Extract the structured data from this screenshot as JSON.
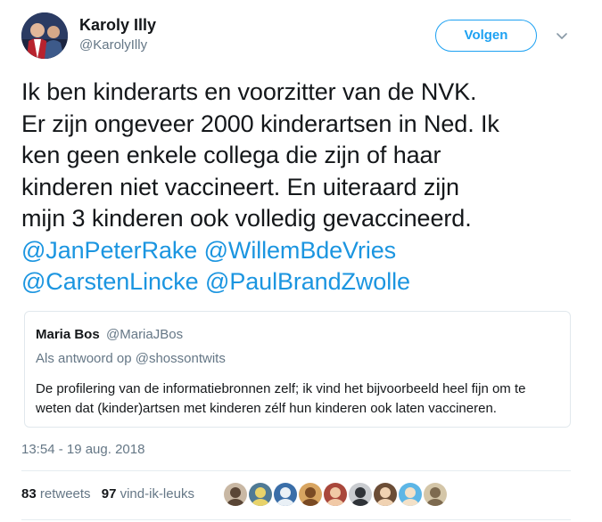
{
  "author": {
    "name": "Karoly Illy",
    "handle": "@KarolyIlly"
  },
  "header": {
    "follow_label": "Volgen",
    "caret_icon": "chevron-down-icon"
  },
  "tweet": {
    "lines": [
      "Ik ben kinderarts en voorzitter van de NVK.",
      "Er zijn ongeveer 2000 kinderartsen in Ned. Ik",
      "ken geen enkele collega die zijn of haar",
      "kinderen niet vaccineert. En uiteraard zijn",
      "mijn 3 kinderen ook volledig gevaccineerd."
    ],
    "mentions": [
      "@JanPeterRake",
      "@WillemBdeVries",
      "@CarstenLincke",
      "@PaulBrandZwolle"
    ]
  },
  "quote": {
    "name": "Maria Bos",
    "handle": "@MariaJBos",
    "reply_to": "Als antwoord op @shossontwits",
    "text_lines": [
      "De profilering van de informatiebronnen zelf; ik vind het bijvoorbeeld heel fijn om te",
      "weten dat (kinder)artsen met kinderen zélf hun kinderen ook laten vaccineren."
    ]
  },
  "timestamp": "13:54 - 19 aug. 2018",
  "stats": {
    "retweets_count": "83",
    "retweets_label": "retweets",
    "likes_count": "97",
    "likes_label": "vind-ik-leuks"
  },
  "colors": {
    "link": "#1b95e0",
    "follow_border": "#1da1f2",
    "secondary_text": "#657786",
    "primary_text": "#14171a",
    "divider": "#e6ecf0"
  },
  "likers": [
    {
      "name": "liker-avatar-1",
      "bg": "#c9b8a4",
      "fg": "#5a4636"
    },
    {
      "name": "liker-avatar-2",
      "bg": "#4f7a95",
      "fg": "#e8d36a"
    },
    {
      "name": "liker-avatar-3",
      "bg": "#3a6ea8",
      "fg": "#e9f0f6"
    },
    {
      "name": "liker-avatar-4",
      "bg": "#d8a561",
      "fg": "#7a4a23"
    },
    {
      "name": "liker-avatar-5",
      "bg": "#a9473b",
      "fg": "#f1c9a6"
    },
    {
      "name": "liker-avatar-6",
      "bg": "#c9ccd0",
      "fg": "#2f3338"
    },
    {
      "name": "liker-avatar-7",
      "bg": "#6b4d36",
      "fg": "#f0d2b2"
    },
    {
      "name": "liker-avatar-8",
      "bg": "#5db6e6",
      "fg": "#f3e1c8"
    },
    {
      "name": "liker-avatar-9",
      "bg": "#d4c6a8",
      "fg": "#7d6a4f"
    }
  ]
}
